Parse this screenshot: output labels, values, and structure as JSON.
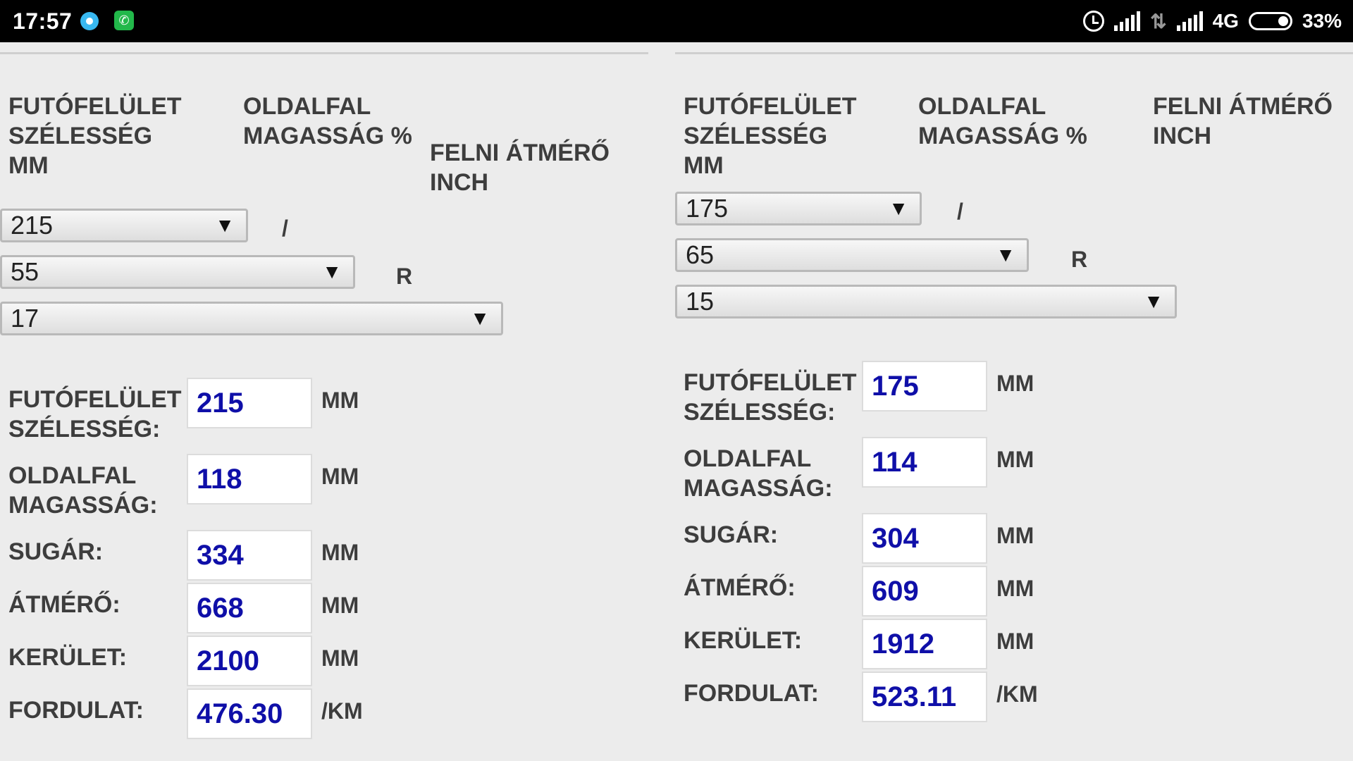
{
  "status_bar": {
    "time": "17:57",
    "network": "4G",
    "battery": "33%"
  },
  "left": {
    "headers": {
      "tread": "FUTÓFELÜLET SZÉLESSÉG MM",
      "sidewall": "OLDALFAL MAGASSÁG %",
      "rim": "FELNI ÁTMÉRŐ INCH"
    },
    "selects": {
      "width": "215",
      "ratio": "55",
      "rim": "17"
    },
    "separator_slash": "/",
    "separator_r": "R",
    "results": [
      {
        "label": "FUTÓFELÜLET SZÉLESSÉG:",
        "value": "215",
        "unit": "MM"
      },
      {
        "label": "OLDALFAL MAGASSÁG:",
        "value": "118",
        "unit": "MM"
      },
      {
        "label": "SUGÁR:",
        "value": "334",
        "unit": "MM"
      },
      {
        "label": "ÁTMÉRŐ:",
        "value": "668",
        "unit": "MM"
      },
      {
        "label": "KERÜLET:",
        "value": "2100",
        "unit": "MM"
      },
      {
        "label": "FORDULAT:",
        "value": "476.30",
        "unit": "/KM"
      }
    ]
  },
  "right": {
    "headers": {
      "tread": "FUTÓFELÜLET SZÉLESSÉG MM",
      "sidewall": "OLDALFAL MAGASSÁG %",
      "rim": "FELNI ÁTMÉRŐ INCH"
    },
    "selects": {
      "width": "175",
      "ratio": "65",
      "rim": "15"
    },
    "separator_slash": "/",
    "separator_r": "R",
    "results": [
      {
        "label": "FUTÓFELÜLET SZÉLESSÉG:",
        "value": "175",
        "unit": "MM"
      },
      {
        "label": "OLDALFAL MAGASSÁG:",
        "value": "114",
        "unit": "MM"
      },
      {
        "label": "SUGÁR:",
        "value": "304",
        "unit": "MM"
      },
      {
        "label": "ÁTMÉRŐ:",
        "value": "609",
        "unit": "MM"
      },
      {
        "label": "KERÜLET:",
        "value": "1912",
        "unit": "MM"
      },
      {
        "label": "FORDULAT:",
        "value": "523.11",
        "unit": "/KM"
      }
    ]
  }
}
